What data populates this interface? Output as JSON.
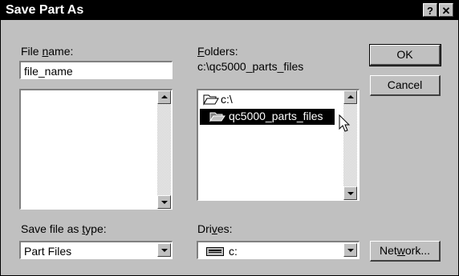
{
  "window": {
    "title": "Save Part As",
    "help_btn": "?",
    "close_btn": "✕"
  },
  "file_name": {
    "label_pre": "File ",
    "label_key": "n",
    "label_post": "ame:",
    "value": "file_name"
  },
  "folders": {
    "label_key": "F",
    "label_post": "olders:",
    "path": "c:\\qc5000_parts_files",
    "items": [
      {
        "label": "c:\\"
      },
      {
        "label": "qc5000_parts_files"
      }
    ]
  },
  "buttons": {
    "ok": "OK",
    "cancel": "Cancel",
    "network_pre": "Net",
    "network_key": "w",
    "network_post": "ork..."
  },
  "save_type": {
    "label_pre": "Save file as ",
    "label_key": "t",
    "label_post": "ype:",
    "value": "Part Files"
  },
  "drives": {
    "label_pre": "Dri",
    "label_key": "v",
    "label_post": "es:",
    "value": "c:"
  },
  "colors": {
    "titlebar": "#000000",
    "face": "#c0c0c0",
    "selection": "#000000"
  }
}
